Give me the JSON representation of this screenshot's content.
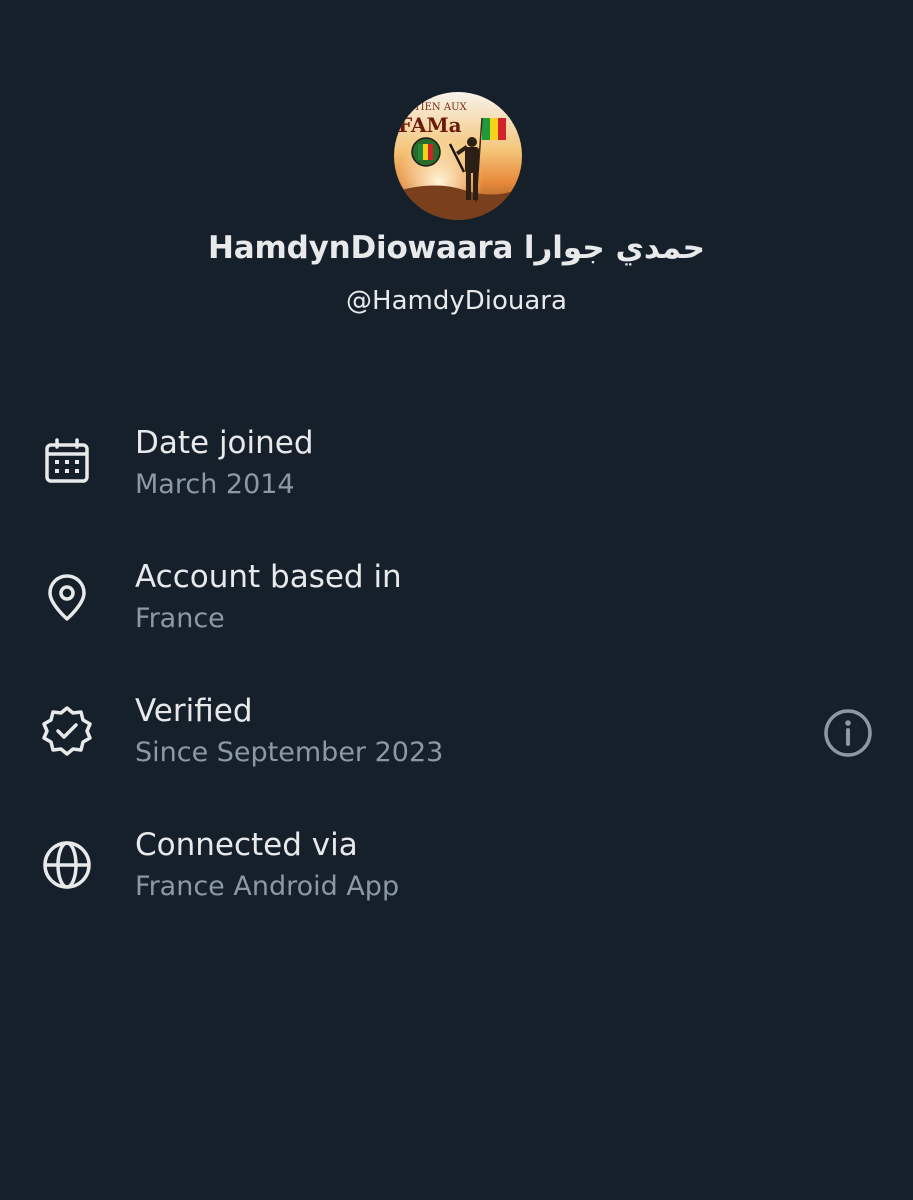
{
  "profile": {
    "display_name": "HamdynDiowaara حمدي جوارا",
    "handle": "@HamdyDiouara",
    "avatar_banner_text": "TIEN AUX",
    "avatar_main_text": "FAMa"
  },
  "about": {
    "rows": [
      {
        "icon": "calendar-icon",
        "title": "Date joined",
        "subtitle": "March 2014"
      },
      {
        "icon": "location-pin-icon",
        "title": "Account based in",
        "subtitle": "France"
      },
      {
        "icon": "verified-badge-icon",
        "title": "Verified",
        "subtitle": "Since September 2023"
      },
      {
        "icon": "globe-icon",
        "title": "Connected via",
        "subtitle": "France Android App"
      }
    ],
    "info_icon": "info-icon"
  },
  "colors": {
    "background": "#16202b",
    "primary_text": "#e7e9ea",
    "secondary_text": "#8b98a5",
    "icon": "#e7e9ea"
  }
}
